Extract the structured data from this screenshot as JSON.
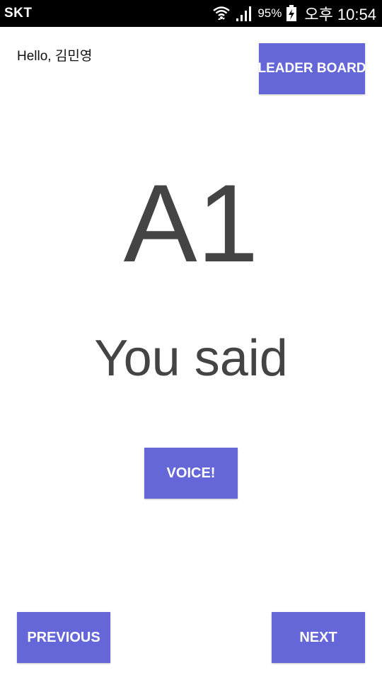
{
  "status_bar": {
    "carrier": "SKT",
    "battery": "95%",
    "time": "오후 10:54",
    "icons": [
      "wifi-icon",
      "signal-icon",
      "battery-charging-icon"
    ]
  },
  "header": {
    "greeting": "Hello, 김민영",
    "leaderboard_label": "LEADER BOARD"
  },
  "main": {
    "word": "A1",
    "result_text": "You said",
    "voice_label": "VOICE!"
  },
  "footer": {
    "previous_label": "PREVIOUS",
    "next_label": "NEXT"
  },
  "colors": {
    "accent": "#6567d8",
    "text": "#444444"
  }
}
